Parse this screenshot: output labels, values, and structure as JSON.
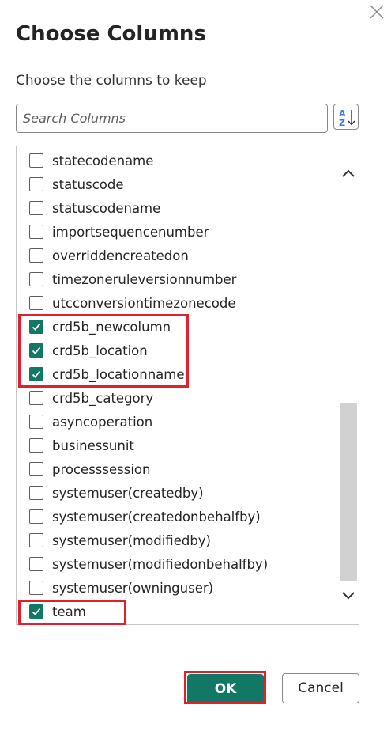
{
  "dialog": {
    "title": "Choose Columns",
    "subtitle": "Choose the columns to keep",
    "close_icon": "close-icon"
  },
  "search": {
    "placeholder": "Search Columns",
    "value": "",
    "sort_icon": "sort-az-icon"
  },
  "columns": [
    {
      "label": "statecodename",
      "checked": false
    },
    {
      "label": "statuscode",
      "checked": false
    },
    {
      "label": "statuscodename",
      "checked": false
    },
    {
      "label": "importsequencenumber",
      "checked": false
    },
    {
      "label": "overriddencreatedon",
      "checked": false
    },
    {
      "label": "timezoneruleversionnumber",
      "checked": false
    },
    {
      "label": "utcconversiontimezonecode",
      "checked": false
    },
    {
      "label": "crd5b_newcolumn",
      "checked": true
    },
    {
      "label": "crd5b_location",
      "checked": true
    },
    {
      "label": "crd5b_locationname",
      "checked": true
    },
    {
      "label": "crd5b_category",
      "checked": false
    },
    {
      "label": "asyncoperation",
      "checked": false
    },
    {
      "label": "businessunit",
      "checked": false
    },
    {
      "label": "processsession",
      "checked": false
    },
    {
      "label": "systemuser(createdby)",
      "checked": false
    },
    {
      "label": "systemuser(createdonbehalfby)",
      "checked": false
    },
    {
      "label": "systemuser(modifiedby)",
      "checked": false
    },
    {
      "label": "systemuser(modifiedonbehalfby)",
      "checked": false
    },
    {
      "label": "systemuser(owninguser)",
      "checked": false
    },
    {
      "label": "team",
      "checked": true
    }
  ],
  "scrollbar": {
    "up_icon": "chevron-up-icon",
    "down_icon": "chevron-down-icon"
  },
  "buttons": {
    "ok_label": "OK",
    "cancel_label": "Cancel"
  },
  "colors": {
    "accent": "#117865",
    "highlight": "#e0202f"
  }
}
